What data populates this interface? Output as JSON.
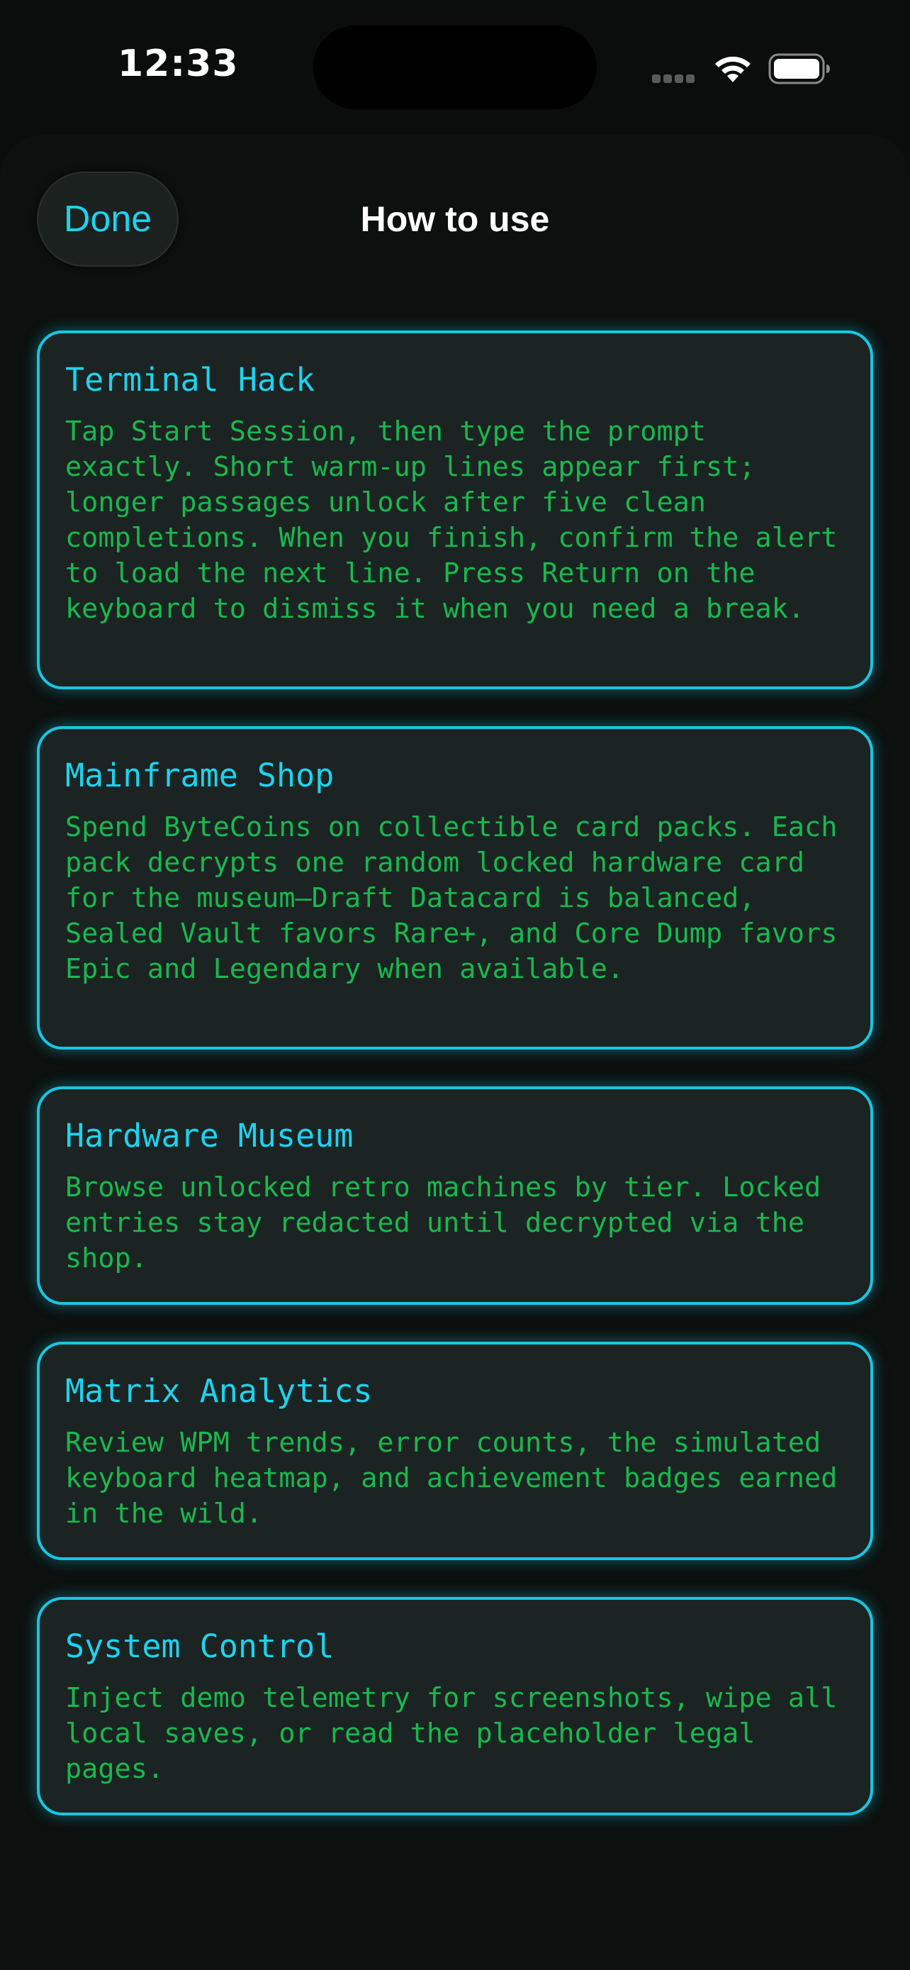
{
  "status_bar": {
    "time": "12:33"
  },
  "header": {
    "done_label": "Done",
    "title": "How to use"
  },
  "colors": {
    "accent_cyan": "#1fd2ee",
    "body_green": "#19b84f",
    "card_background": "#1b2422",
    "background": "#0a0d0b"
  },
  "cards": [
    {
      "title": "Terminal Hack",
      "body": "Tap Start Session, then type the prompt exactly. Short warm-up lines appear first; longer passages unlock after five clean completions. When you finish, confirm the alert to load the next line. Press Return on the keyboard to dismiss it when you need a break."
    },
    {
      "title": "Mainframe Shop",
      "body": "Spend ByteCoins on collectible card packs. Each pack decrypts one random locked hardware card for the museum—Draft Datacard is balanced, Sealed Vault favors Rare+, and Core Dump favors Epic and Legendary when available."
    },
    {
      "title": "Hardware Museum",
      "body": "Browse unlocked retro machines by tier. Locked entries stay redacted until decrypted via the shop."
    },
    {
      "title": "Matrix Analytics",
      "body": "Review WPM trends, error counts, the simulated keyboard heatmap, and achievement badges earned in the wild."
    },
    {
      "title": "System Control",
      "body": "Inject demo telemetry for screenshots, wipe all local saves, or read the placeholder legal pages."
    }
  ]
}
